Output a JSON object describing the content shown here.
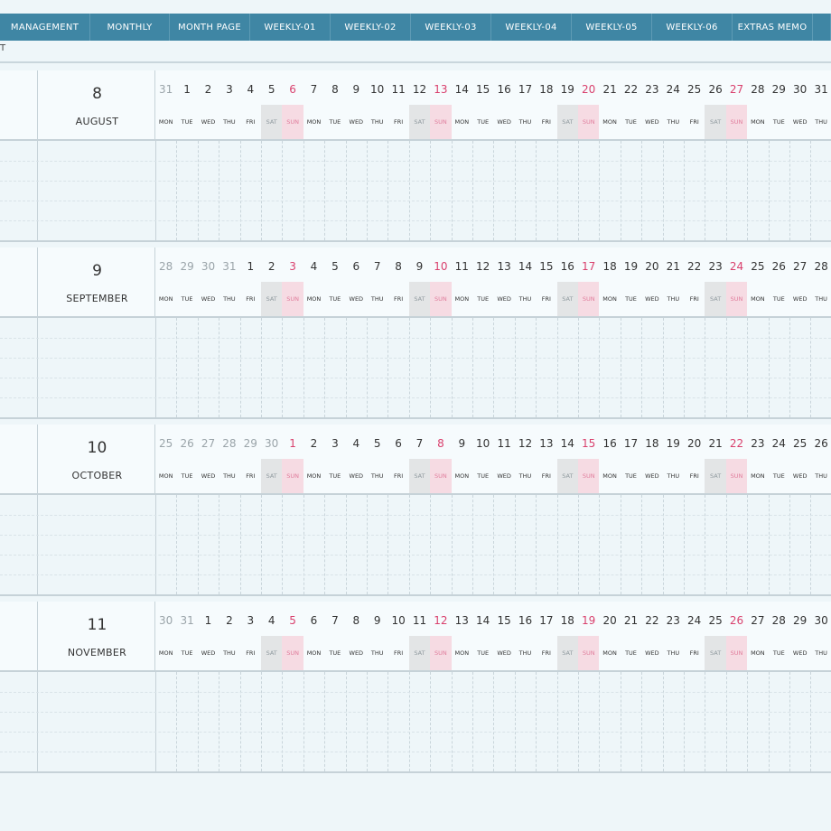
{
  "tabs": [
    {
      "label": "MANAGEMENT"
    },
    {
      "label": "MONTHLY"
    },
    {
      "label": "MONTH PAGE"
    },
    {
      "label": "WEEKLY-01"
    },
    {
      "label": "WEEKLY-02"
    },
    {
      "label": "WEEKLY-03"
    },
    {
      "label": "WEEKLY-04"
    },
    {
      "label": "WEEKLY-05"
    },
    {
      "label": "WEEKLY-06"
    },
    {
      "label": "EXTRAS MEMO"
    }
  ],
  "corner_text": "T",
  "months": [
    {
      "number": "8",
      "name": "AUGUST",
      "days": [
        {
          "n": "31",
          "d": "MON",
          "prev": true
        },
        {
          "n": "1",
          "d": "TUE"
        },
        {
          "n": "2",
          "d": "WED"
        },
        {
          "n": "3",
          "d": "THU"
        },
        {
          "n": "4",
          "d": "FRI"
        },
        {
          "n": "5",
          "d": "SAT"
        },
        {
          "n": "6",
          "d": "SUN"
        },
        {
          "n": "7",
          "d": "MON"
        },
        {
          "n": "8",
          "d": "TUE"
        },
        {
          "n": "9",
          "d": "WED"
        },
        {
          "n": "10",
          "d": "THU"
        },
        {
          "n": "11",
          "d": "FRI"
        },
        {
          "n": "12",
          "d": "SAT"
        },
        {
          "n": "13",
          "d": "SUN"
        },
        {
          "n": "14",
          "d": "MON"
        },
        {
          "n": "15",
          "d": "TUE"
        },
        {
          "n": "16",
          "d": "WED"
        },
        {
          "n": "17",
          "d": "THU"
        },
        {
          "n": "18",
          "d": "FRI"
        },
        {
          "n": "19",
          "d": "SAT"
        },
        {
          "n": "20",
          "d": "SUN"
        },
        {
          "n": "21",
          "d": "MON"
        },
        {
          "n": "22",
          "d": "TUE"
        },
        {
          "n": "23",
          "d": "WED"
        },
        {
          "n": "24",
          "d": "THU"
        },
        {
          "n": "25",
          "d": "FRI"
        },
        {
          "n": "26",
          "d": "SAT"
        },
        {
          "n": "27",
          "d": "SUN"
        },
        {
          "n": "28",
          "d": "MON"
        },
        {
          "n": "29",
          "d": "TUE"
        },
        {
          "n": "30",
          "d": "WED"
        },
        {
          "n": "31",
          "d": "THU"
        }
      ]
    },
    {
      "number": "9",
      "name": "SEPTEMBER",
      "days": [
        {
          "n": "28",
          "d": "MON",
          "prev": true
        },
        {
          "n": "29",
          "d": "TUE",
          "prev": true
        },
        {
          "n": "30",
          "d": "WED",
          "prev": true
        },
        {
          "n": "31",
          "d": "THU",
          "prev": true
        },
        {
          "n": "1",
          "d": "FRI"
        },
        {
          "n": "2",
          "d": "SAT"
        },
        {
          "n": "3",
          "d": "SUN"
        },
        {
          "n": "4",
          "d": "MON"
        },
        {
          "n": "5",
          "d": "TUE"
        },
        {
          "n": "6",
          "d": "WED"
        },
        {
          "n": "7",
          "d": "THU"
        },
        {
          "n": "8",
          "d": "FRI"
        },
        {
          "n": "9",
          "d": "SAT"
        },
        {
          "n": "10",
          "d": "SUN"
        },
        {
          "n": "11",
          "d": "MON"
        },
        {
          "n": "12",
          "d": "TUE"
        },
        {
          "n": "13",
          "d": "WED"
        },
        {
          "n": "14",
          "d": "THU"
        },
        {
          "n": "15",
          "d": "FRI"
        },
        {
          "n": "16",
          "d": "SAT"
        },
        {
          "n": "17",
          "d": "SUN"
        },
        {
          "n": "18",
          "d": "MON"
        },
        {
          "n": "19",
          "d": "TUE"
        },
        {
          "n": "20",
          "d": "WED"
        },
        {
          "n": "21",
          "d": "THU"
        },
        {
          "n": "22",
          "d": "FRI"
        },
        {
          "n": "23",
          "d": "SAT"
        },
        {
          "n": "24",
          "d": "SUN"
        },
        {
          "n": "25",
          "d": "MON"
        },
        {
          "n": "26",
          "d": "TUE"
        },
        {
          "n": "27",
          "d": "WED"
        },
        {
          "n": "28",
          "d": "THU"
        }
      ]
    },
    {
      "number": "10",
      "name": "OCTOBER",
      "days": [
        {
          "n": "25",
          "d": "MON",
          "prev": true
        },
        {
          "n": "26",
          "d": "TUE",
          "prev": true
        },
        {
          "n": "27",
          "d": "WED",
          "prev": true
        },
        {
          "n": "28",
          "d": "THU",
          "prev": true
        },
        {
          "n": "29",
          "d": "FRI",
          "prev": true
        },
        {
          "n": "30",
          "d": "SAT",
          "prev": true
        },
        {
          "n": "1",
          "d": "SUN"
        },
        {
          "n": "2",
          "d": "MON"
        },
        {
          "n": "3",
          "d": "TUE"
        },
        {
          "n": "4",
          "d": "WED"
        },
        {
          "n": "5",
          "d": "THU"
        },
        {
          "n": "6",
          "d": "FRI"
        },
        {
          "n": "7",
          "d": "SAT"
        },
        {
          "n": "8",
          "d": "SUN"
        },
        {
          "n": "9",
          "d": "MON"
        },
        {
          "n": "10",
          "d": "TUE"
        },
        {
          "n": "11",
          "d": "WED"
        },
        {
          "n": "12",
          "d": "THU"
        },
        {
          "n": "13",
          "d": "FRI"
        },
        {
          "n": "14",
          "d": "SAT"
        },
        {
          "n": "15",
          "d": "SUN"
        },
        {
          "n": "16",
          "d": "MON"
        },
        {
          "n": "17",
          "d": "TUE"
        },
        {
          "n": "18",
          "d": "WED"
        },
        {
          "n": "19",
          "d": "THU"
        },
        {
          "n": "20",
          "d": "FRI"
        },
        {
          "n": "21",
          "d": "SAT"
        },
        {
          "n": "22",
          "d": "SUN"
        },
        {
          "n": "23",
          "d": "MON"
        },
        {
          "n": "24",
          "d": "TUE"
        },
        {
          "n": "25",
          "d": "WED"
        },
        {
          "n": "26",
          "d": "THU"
        }
      ]
    },
    {
      "number": "11",
      "name": "NOVEMBER",
      "days": [
        {
          "n": "30",
          "d": "MON",
          "prev": true
        },
        {
          "n": "31",
          "d": "TUE",
          "prev": true
        },
        {
          "n": "1",
          "d": "WED"
        },
        {
          "n": "2",
          "d": "THU"
        },
        {
          "n": "3",
          "d": "FRI"
        },
        {
          "n": "4",
          "d": "SAT"
        },
        {
          "n": "5",
          "d": "SUN"
        },
        {
          "n": "6",
          "d": "MON"
        },
        {
          "n": "7",
          "d": "TUE"
        },
        {
          "n": "8",
          "d": "WED"
        },
        {
          "n": "9",
          "d": "THU"
        },
        {
          "n": "10",
          "d": "FRI"
        },
        {
          "n": "11",
          "d": "SAT"
        },
        {
          "n": "12",
          "d": "SUN"
        },
        {
          "n": "13",
          "d": "MON"
        },
        {
          "n": "14",
          "d": "TUE"
        },
        {
          "n": "15",
          "d": "WED"
        },
        {
          "n": "16",
          "d": "THU"
        },
        {
          "n": "17",
          "d": "FRI"
        },
        {
          "n": "18",
          "d": "SAT"
        },
        {
          "n": "19",
          "d": "SUN"
        },
        {
          "n": "20",
          "d": "MON"
        },
        {
          "n": "21",
          "d": "TUE"
        },
        {
          "n": "22",
          "d": "WED"
        },
        {
          "n": "23",
          "d": "THU"
        },
        {
          "n": "24",
          "d": "FRI"
        },
        {
          "n": "25",
          "d": "SAT"
        },
        {
          "n": "26",
          "d": "SUN"
        },
        {
          "n": "27",
          "d": "MON"
        },
        {
          "n": "28",
          "d": "TUE"
        },
        {
          "n": "29",
          "d": "WED"
        },
        {
          "n": "30",
          "d": "THU"
        }
      ]
    }
  ]
}
